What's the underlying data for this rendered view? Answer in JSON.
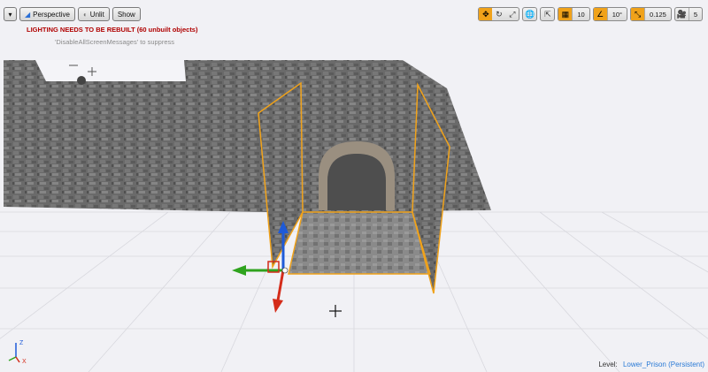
{
  "toolbar_left": {
    "menu_icon": "chevron-down-icon",
    "perspective_label": "Perspective",
    "unlit_label": "Unlit",
    "show_label": "Show"
  },
  "messages": {
    "warning": "LIGHTING NEEDS TO BE REBUILT (60 unbuilt objects)",
    "hint": "'DisableAllScreenMessages' to suppress"
  },
  "toolbar_right": {
    "grid_value": "10",
    "rotation_value": "10°",
    "scale_value": "0.125",
    "camera_speed_value": "5"
  },
  "status": {
    "level_label": "Level:",
    "level_name": "Lower_Prison (Persistent)"
  },
  "axis_labels": {
    "z": "Z",
    "x": "X"
  },
  "colors": {
    "selection": "#f0a21a",
    "gizmo_x": "#d42c1a",
    "gizmo_y": "#2fa31e",
    "gizmo_z": "#1e5ad8",
    "warning": "#b00000"
  }
}
